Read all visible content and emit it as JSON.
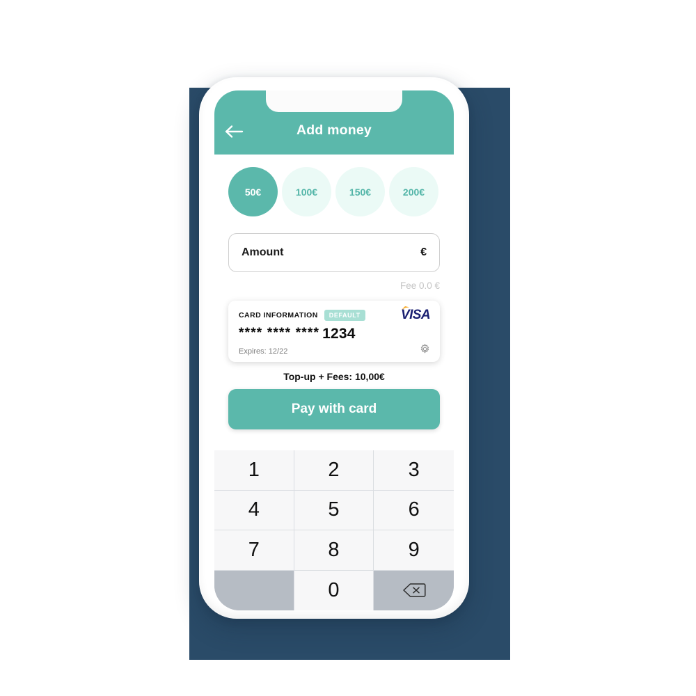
{
  "colors": {
    "teal": "#5bb8ab",
    "mint_light": "#ebfaf6",
    "badge_mint": "#a8dfd4",
    "navy_backdrop": "#2a4b68",
    "visa_navy": "#1a1f71",
    "visa_gold": "#f7a823",
    "key_face": "#f7f7f8",
    "key_gray": "#b6bcc4"
  },
  "header": {
    "title": "Add money",
    "back_icon": "arrow-left-icon"
  },
  "presets": [
    {
      "label": "50€",
      "selected": true
    },
    {
      "label": "100€",
      "selected": false
    },
    {
      "label": "150€",
      "selected": false
    },
    {
      "label": "200€",
      "selected": false
    }
  ],
  "amount": {
    "placeholder": "Amount",
    "value": "",
    "currency": "€",
    "fee_text": "Fee 0.0 €"
  },
  "card": {
    "label": "CARD INFORMATION",
    "badge": "DEFAULT",
    "brand": "VISA",
    "masked": "**** **** ****",
    "last4": "1234",
    "expiry": "Expires: 12/22",
    "settings_icon": "gear-icon"
  },
  "summary": {
    "total_text": "Top-up + Fees: 10,00€",
    "pay_label": "Pay with card"
  },
  "keypad": {
    "keys": [
      "1",
      "2",
      "3",
      "4",
      "5",
      "6",
      "7",
      "8",
      "9"
    ],
    "blank": "",
    "zero": "0",
    "delete_icon": "backspace-icon"
  }
}
